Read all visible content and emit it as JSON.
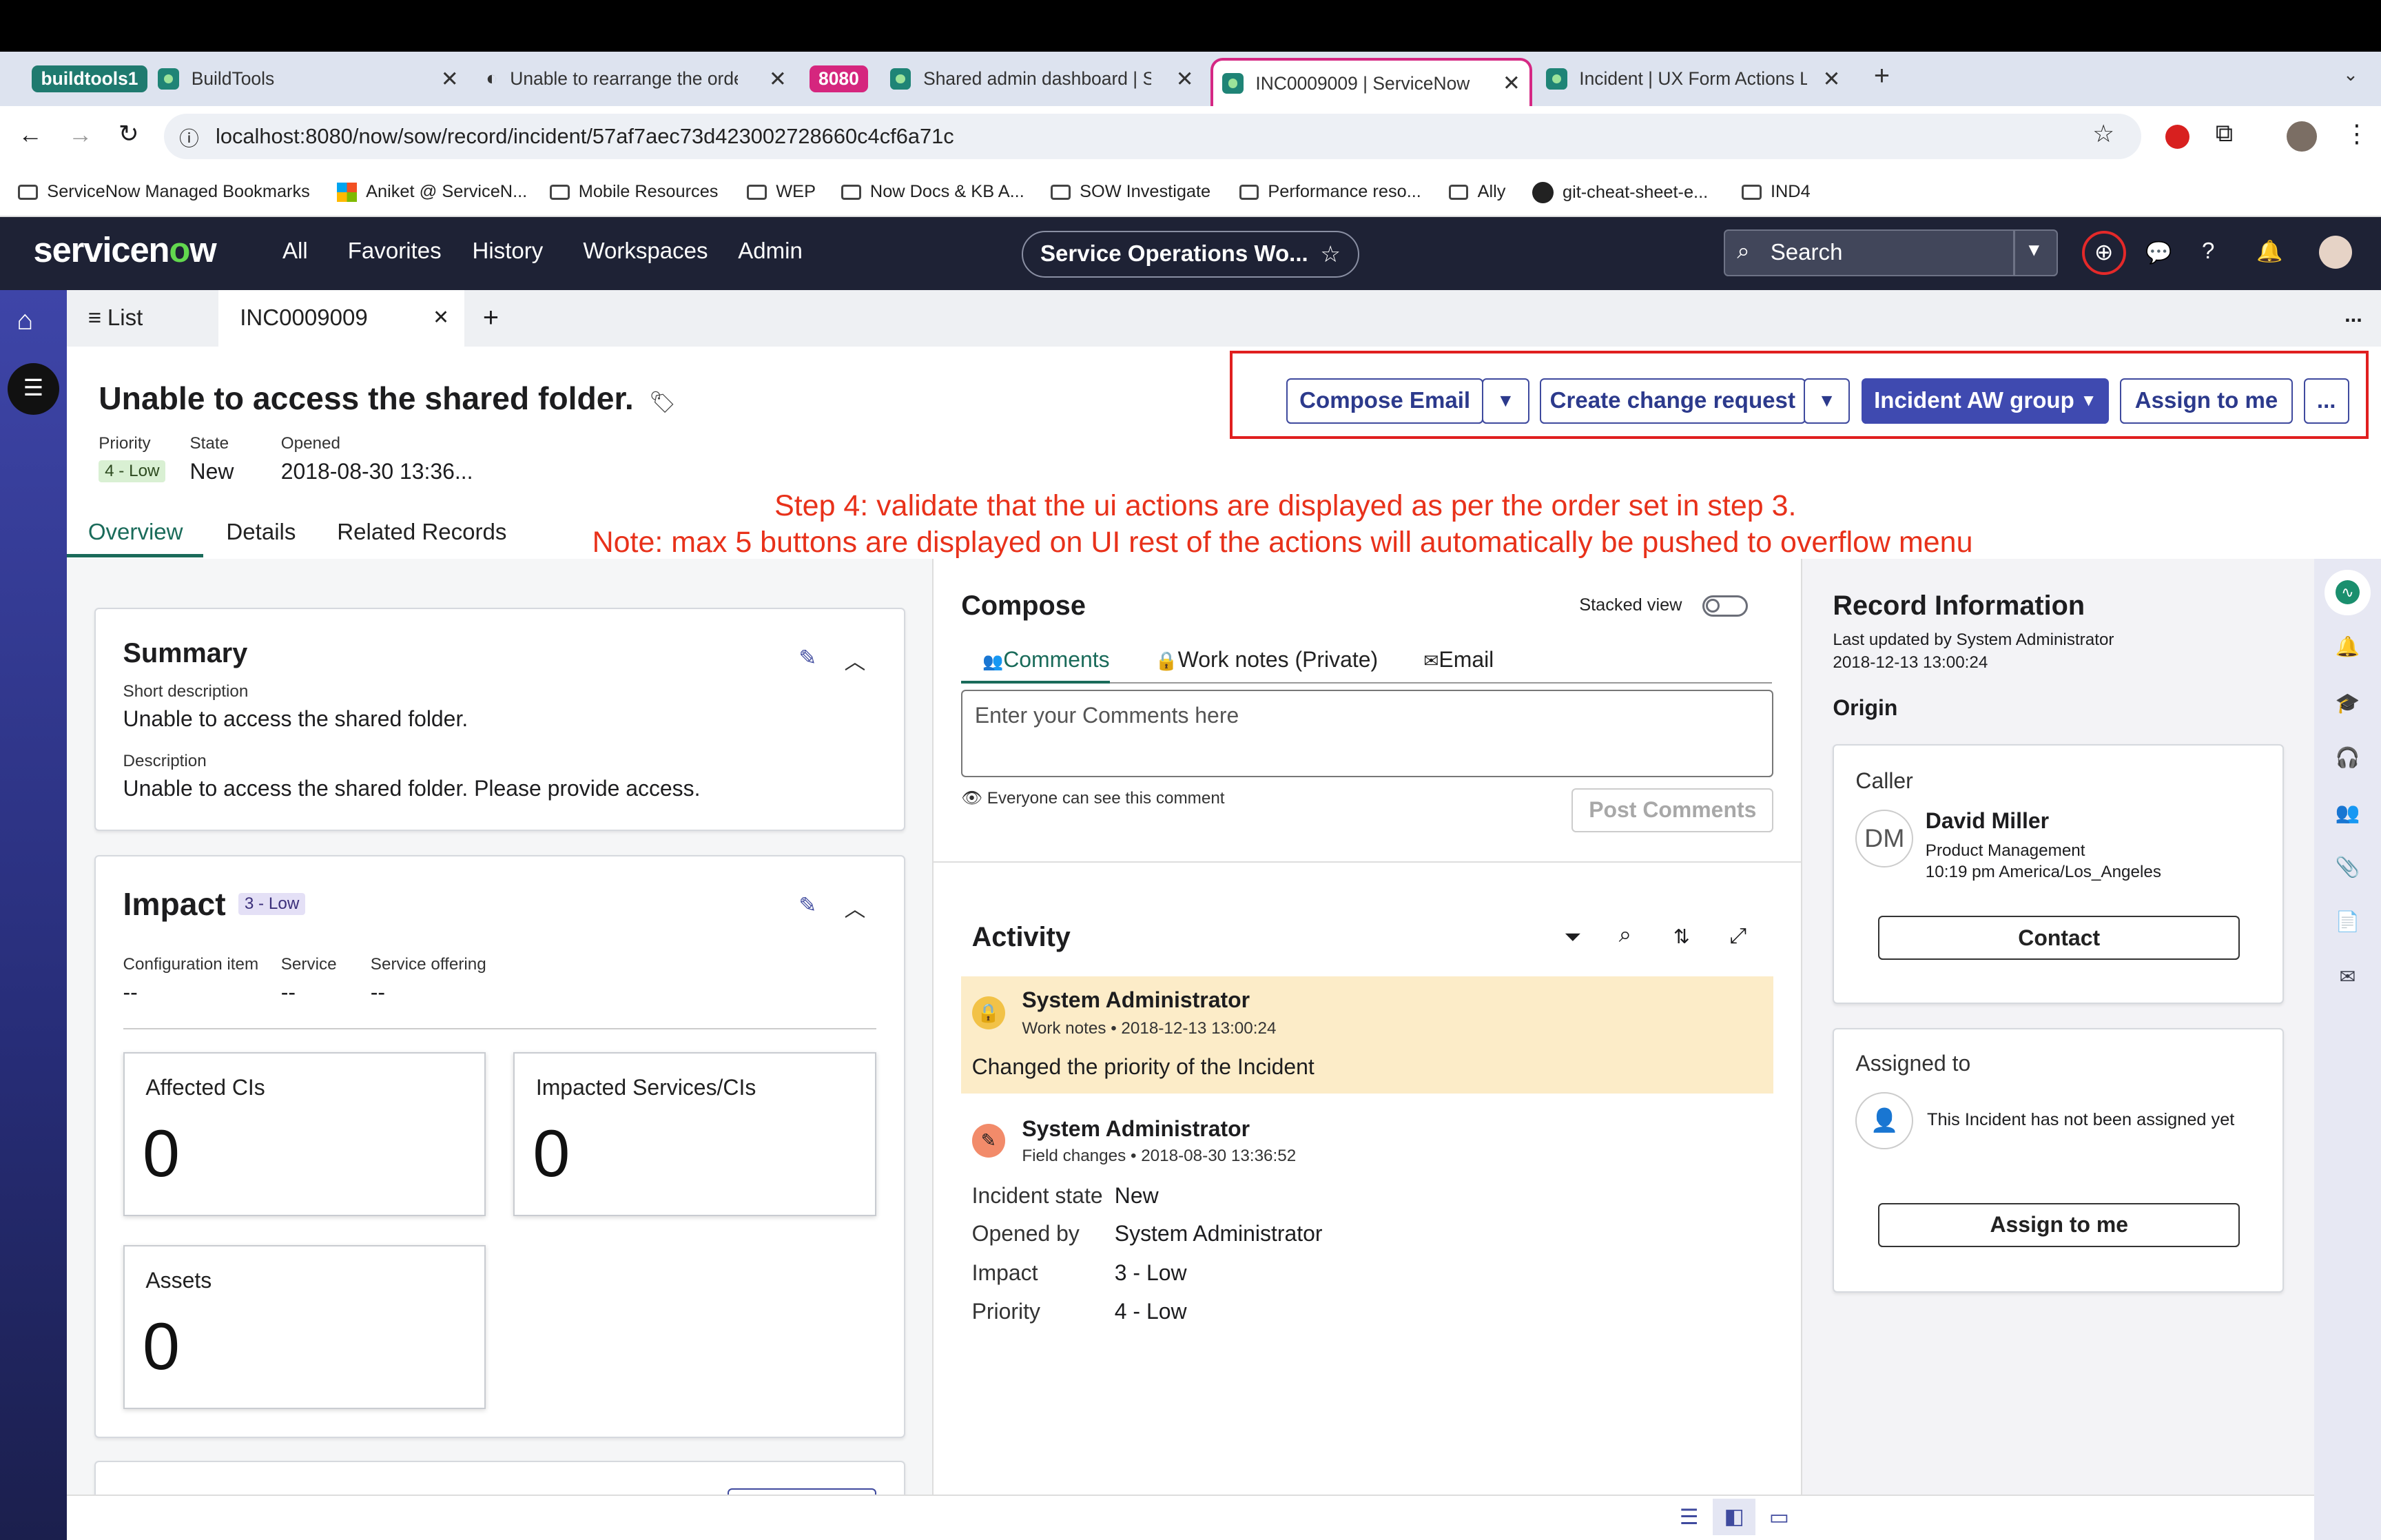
{
  "browser": {
    "tabs": [
      {
        "group": "buildtools1",
        "title": "BuildTools"
      },
      {
        "title": "Unable to rearrange the order"
      },
      {
        "group": "8080",
        "title": "Shared admin dashboard | Se"
      },
      {
        "title": "INC0009009 | ServiceNow"
      },
      {
        "title": "Incident | UX Form Actions La"
      }
    ],
    "new_tab": "+",
    "url": "localhost:8080/now/sow/record/incident/57af7aec73d423002728660c4cf6a71c",
    "bookmarks": [
      "ServiceNow Managed Bookmarks",
      "Aniket @ ServiceN...",
      "Mobile Resources",
      "WEP",
      "Now Docs & KB A...",
      "SOW Investigate",
      "Performance reso...",
      "Ally",
      "git-cheat-sheet-e...",
      "IND4"
    ]
  },
  "snnav": {
    "logo_a": "servicen",
    "logo_o": "o",
    "logo_b": "w",
    "items": [
      "All",
      "Favorites",
      "History",
      "Workspaces",
      "Admin"
    ],
    "workspace": "Service Operations Wo...",
    "search": "Search"
  },
  "wstabs": {
    "list": "List",
    "record": "INC0009009",
    "add": "+",
    "more": "..."
  },
  "record": {
    "title": "Unable to access the shared folder.",
    "priority_label": "Priority",
    "priority": "4 - Low",
    "state_label": "State",
    "state": "New",
    "opened_label": "Opened",
    "opened": "2018-08-30 13:36..."
  },
  "actions": {
    "compose_email": "Compose Email",
    "create_change": "Create change request",
    "aw_group": "Incident AW group",
    "assign": "Assign to me",
    "more": "..."
  },
  "annotation": {
    "line1": "Step 4: validate that the ui actions are displayed as per the order set in step 3.",
    "line2": "Note: max 5 buttons are displayed on UI rest of the actions will automatically be pushed to overflow menu"
  },
  "subtabs": [
    "Overview",
    "Details",
    "Related Records"
  ],
  "summary": {
    "title": "Summary",
    "short_label": "Short description",
    "short": "Unable to access the shared folder.",
    "desc_label": "Description",
    "desc": "Unable to access the shared folder. Please provide access."
  },
  "impact": {
    "title": "Impact",
    "badge": "3 - Low",
    "ci_label": "Configuration item",
    "ci": "--",
    "service_label": "Service",
    "service": "--",
    "offering_label": "Service offering",
    "offering": "--",
    "cards": [
      {
        "label": "Affected CIs",
        "value": "0"
      },
      {
        "label": "Impacted Services/CIs",
        "value": "0"
      },
      {
        "label": "Assets",
        "value": "0"
      }
    ]
  },
  "compose": {
    "title": "Compose",
    "stacked": "Stacked view",
    "tabs": [
      "Comments",
      "Work notes (Private)",
      "Email"
    ],
    "placeholder": "Enter your Comments here",
    "visibility": "Everyone can see this comment",
    "post": "Post Comments"
  },
  "activity": {
    "title": "Activity",
    "entries": [
      {
        "user": "System Administrator",
        "type": "Work notes",
        "time": "2018-12-13 13:00:24",
        "text": "Changed the priority of the Incident"
      },
      {
        "user": "System Administrator",
        "type": "Field changes",
        "time": "2018-08-30 13:36:52"
      }
    ],
    "fields": [
      {
        "k": "Incident state",
        "v": "New"
      },
      {
        "k": "Opened by",
        "v": "System Administrator"
      },
      {
        "k": "Impact",
        "v": "3 - Low"
      },
      {
        "k": "Priority",
        "v": "4 - Low"
      }
    ]
  },
  "recordinfo": {
    "title": "Record Information",
    "updated_by": "Last updated by System Administrator",
    "updated": "2018-12-13 13:00:24",
    "origin": "Origin",
    "caller_label": "Caller",
    "initials": "DM",
    "caller": "David Miller",
    "dept": "Product Management",
    "localtime": "10:19 pm America/Los_Angeles",
    "contact": "Contact",
    "assigned_label": "Assigned to",
    "unassigned": "This Incident has not been assigned yet",
    "assign": "Assign to me"
  },
  "colors": {
    "accent": "#3f4a9e",
    "annotation": "#e8311a",
    "nav": "#1e2235"
  }
}
